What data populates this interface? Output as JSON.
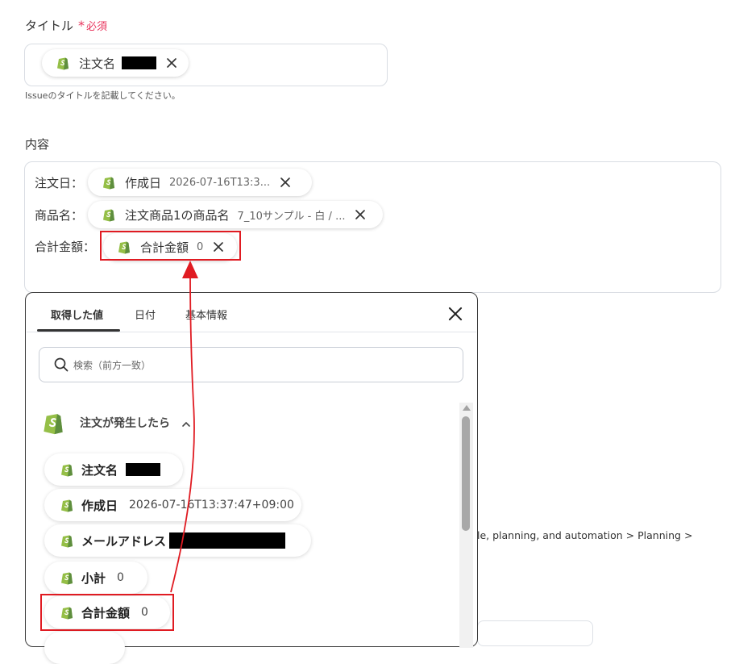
{
  "title_field": {
    "label": "タイトル",
    "required_star": "*",
    "required_text": "必須",
    "chip": {
      "name": "注文名"
    },
    "helper": "Issueのタイトルを記載してください。"
  },
  "content_field": {
    "label": "内容",
    "rows": [
      {
        "label": "注文日：",
        "chip_name": "作成日",
        "chip_value": "2026-07-16T13:3..."
      },
      {
        "label": "商品名：",
        "chip_name": "注文商品1の商品名",
        "chip_value": "7_10サンプル - 白 / ..."
      },
      {
        "label": "合計金額：",
        "chip_name": "合計金額",
        "chip_value": "0"
      }
    ]
  },
  "background": {
    "partial_text": "le, planning, and automation > Planning >"
  },
  "picker": {
    "tabs": [
      {
        "label": "取得した値",
        "active": true
      },
      {
        "label": "日付",
        "active": false
      },
      {
        "label": "基本情報",
        "active": false
      }
    ],
    "search_placeholder": "検索（前方一致）",
    "group": {
      "label": "注文が発生したら",
      "expanded": true
    },
    "items": [
      {
        "name": "注文名",
        "value": ""
      },
      {
        "name": "作成日",
        "value": "2026-07-16T13:37:47+09:00"
      },
      {
        "name": "メールアドレス",
        "value": ""
      },
      {
        "name": "小計",
        "value": "0"
      },
      {
        "name": "合計金額",
        "value": "0"
      }
    ]
  },
  "colors": {
    "accent_red": "#e01b22",
    "required_pink": "#e8345c",
    "shopify_green": "#95bf47"
  },
  "icons": [
    "shopify-icon",
    "close-icon",
    "search-icon",
    "chevron-up-icon",
    "arrow-annotation"
  ]
}
